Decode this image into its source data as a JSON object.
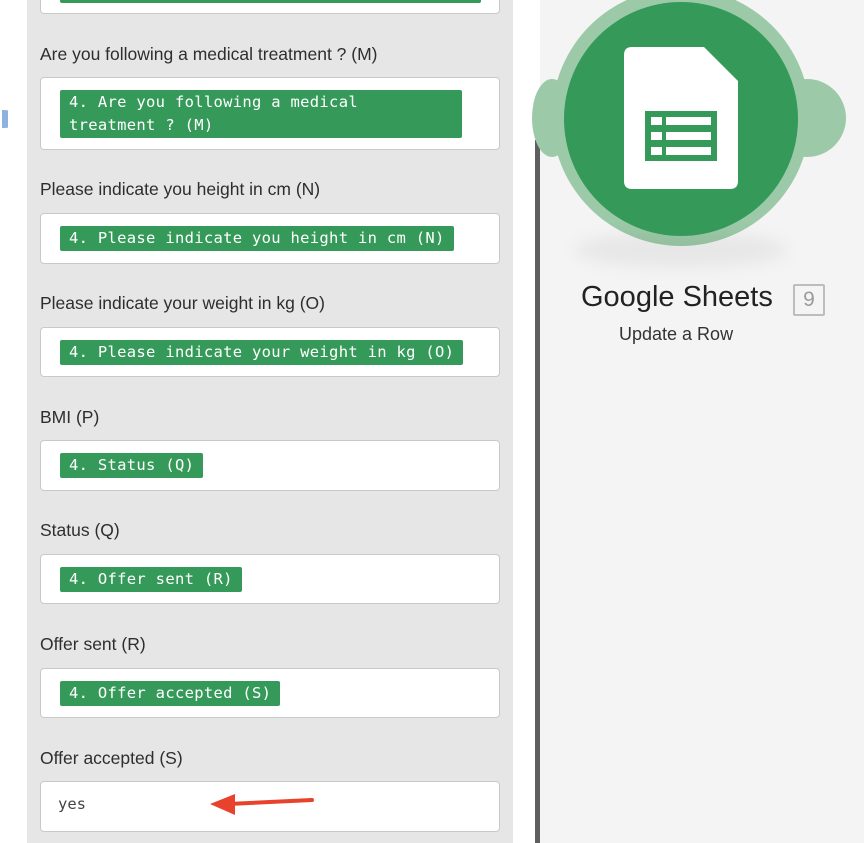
{
  "form": {
    "fields": [
      {
        "label": "Are you following a medical treatment ? (M)",
        "value": "4. Are you following a medical treatment ? (M)"
      },
      {
        "label": "Please indicate you height in cm (N)",
        "value": "4. Please indicate you height in cm (N)"
      },
      {
        "label": "Please indicate your weight in kg (O)",
        "value": "4. Please indicate your weight in kg (O)"
      },
      {
        "label": "BMI (P)",
        "value": "4. Status (Q)"
      },
      {
        "label": "Status (Q)",
        "value": "4. Offer sent (R)"
      },
      {
        "label": "Offer sent (R)",
        "value": "4. Offer accepted (S)"
      },
      {
        "label": "Offer accepted (S)",
        "value": "yes"
      }
    ]
  },
  "module": {
    "app_name": "Google Sheets",
    "badge": "9",
    "action": "Update a Row",
    "icon": "google-sheets-icon",
    "colors": {
      "brand": "#359a59",
      "halo": "#9ccaa8",
      "arrow": "#e8412c"
    }
  }
}
